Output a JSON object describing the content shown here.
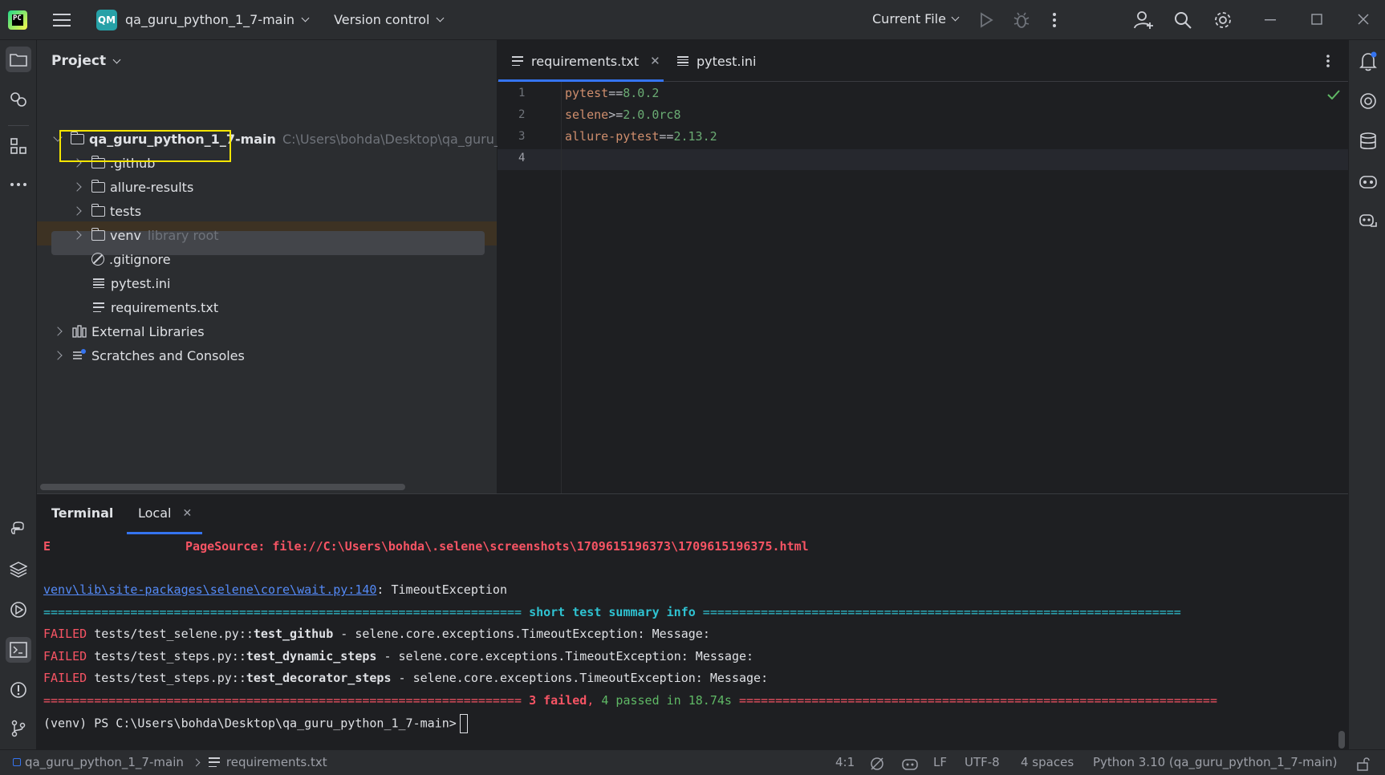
{
  "titlebar": {
    "project_badge": "QM",
    "project_name": "qa_guru_python_1_7-main",
    "vcs_label": "Version control",
    "run_config": "Current File"
  },
  "project_panel": {
    "title": "Project",
    "root": {
      "name": "qa_guru_python_1_7-main",
      "path": "C:\\Users\\bohda\\Desktop\\qa_guru_p"
    },
    "items": [
      {
        "name": ".github",
        "type": "folder"
      },
      {
        "name": "allure-results",
        "type": "folder"
      },
      {
        "name": "tests",
        "type": "folder"
      },
      {
        "name": "venv",
        "type": "folder",
        "hint": "library root"
      },
      {
        "name": ".gitignore",
        "type": "file"
      },
      {
        "name": "pytest.ini",
        "type": "file"
      },
      {
        "name": "requirements.txt",
        "type": "file"
      },
      {
        "name": "External Libraries",
        "type": "libraries"
      },
      {
        "name": "Scratches and Consoles",
        "type": "scratches"
      }
    ]
  },
  "editor": {
    "tabs": [
      {
        "label": "requirements.txt",
        "active": true
      },
      {
        "label": "pytest.ini",
        "active": false
      }
    ],
    "lines": [
      {
        "num": "1",
        "pkg": "pytest",
        "op": "==",
        "ver": "8.0.2"
      },
      {
        "num": "2",
        "pkg": "selene",
        "op": ">=",
        "ver": "2.0.0rc8"
      },
      {
        "num": "3",
        "pkg": "allure-pytest",
        "op": "==",
        "ver": "2.13.2"
      },
      {
        "num": "4",
        "pkg": "",
        "op": "",
        "ver": ""
      }
    ]
  },
  "terminal": {
    "title": "Terminal",
    "tab": "Local",
    "page_source_prefix": "E",
    "page_source": "PageSource: file://C:\\Users\\bohda\\.selene\\screenshots\\1709615196373\\1709615196375.html",
    "wait_link": "venv\\lib\\site-packages\\selene\\core\\wait.py:140",
    "wait_suffix": ": TimeoutException",
    "summary_left": "================================================================== ",
    "summary_title": "short test summary info",
    "summary_right": " ==================================================================",
    "failed_label": "FAILED",
    "failures": [
      {
        "path": "tests/test_selene.py::",
        "test": "test_github",
        "msg": " - selene.core.exceptions.TimeoutException: Message:"
      },
      {
        "path": "tests/test_steps.py::",
        "test": "test_dynamic_steps",
        "msg": " - selene.core.exceptions.TimeoutException: Message:"
      },
      {
        "path": "tests/test_steps.py::",
        "test": "test_decorator_steps",
        "msg": " - selene.core.exceptions.TimeoutException: Message:"
      }
    ],
    "result_left": "================================================================== ",
    "result_failed": "3 failed",
    "result_sep": ", ",
    "result_passed": "4 passed in 18.74s",
    "result_right": " ==================================================================",
    "prompt": "(venv) PS C:\\Users\\bohda\\Desktop\\qa_guru_python_1_7-main>"
  },
  "statusbar": {
    "project": "qa_guru_python_1_7-main",
    "file": "requirements.txt",
    "position": "4:1",
    "line_sep": "LF",
    "encoding": "UTF-8",
    "indent": "4 spaces",
    "interpreter": "Python 3.10 (qa_guru_python_1_7-main)"
  },
  "colors": {
    "accent": "#3574f0",
    "highlight_box": "#f5e600",
    "error": "#f75464",
    "success": "#5fb865"
  }
}
